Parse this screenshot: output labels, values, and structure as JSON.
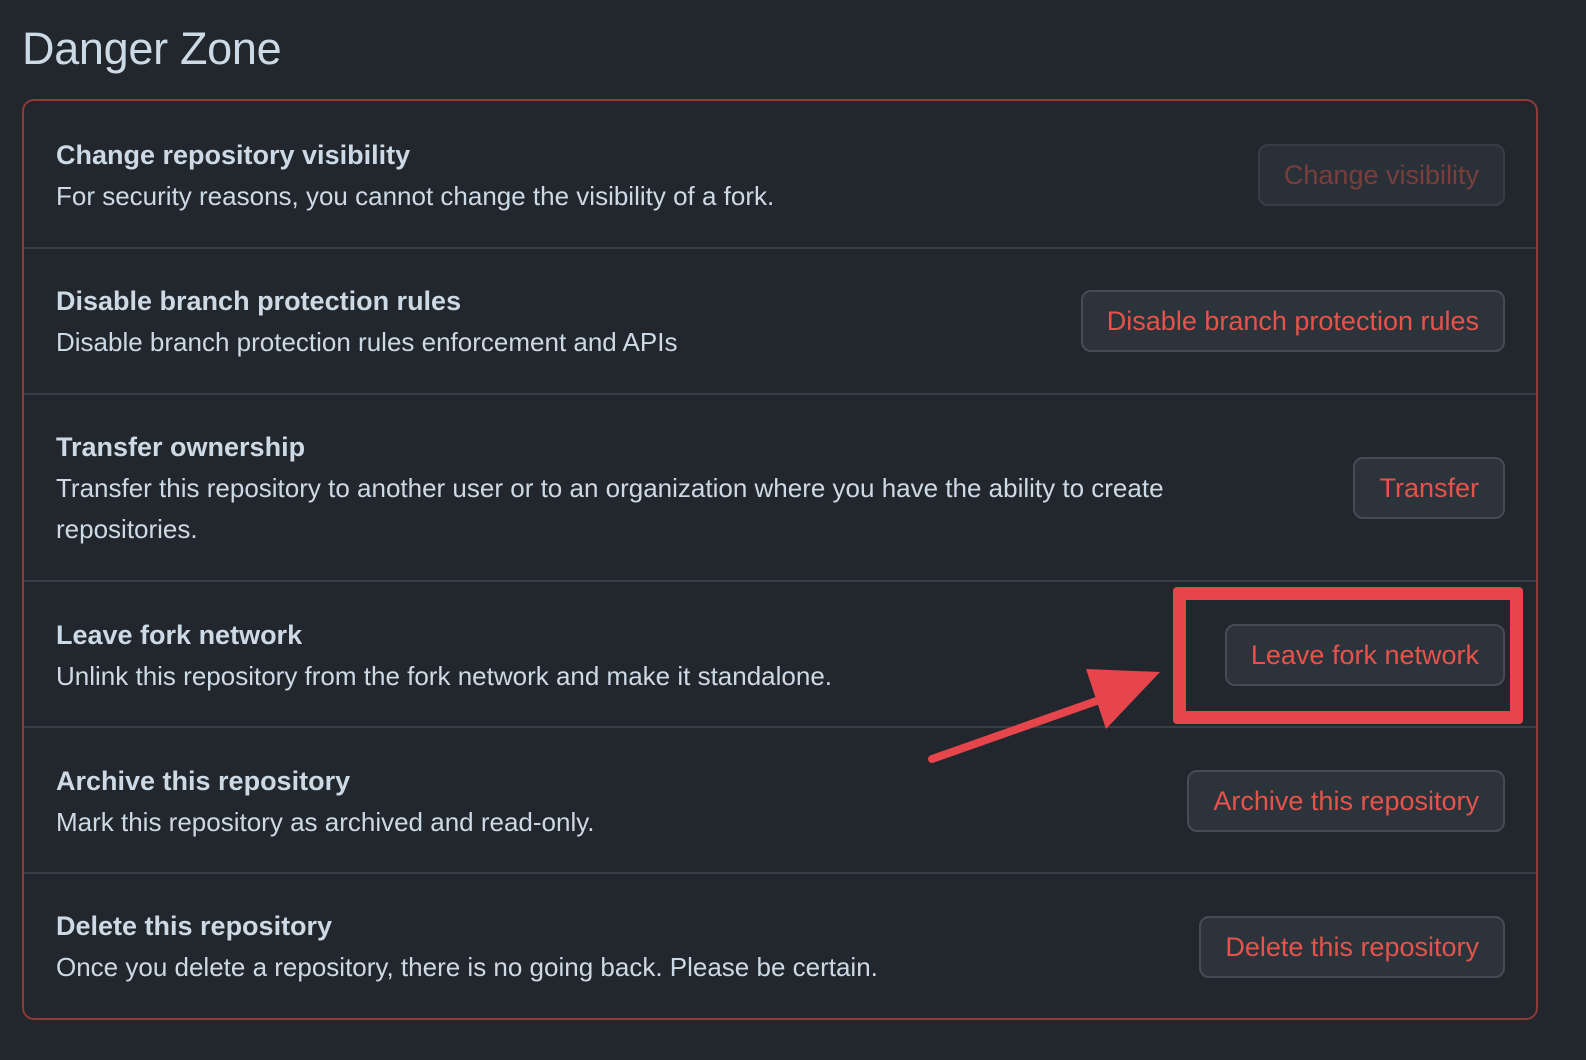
{
  "page": {
    "title": "Danger Zone"
  },
  "settings": [
    {
      "heading": "Change repository visibility",
      "description": "For security reasons, you cannot change the visibility of a fork.",
      "button": "Change visibility",
      "disabled": true
    },
    {
      "heading": "Disable branch protection rules",
      "description": "Disable branch protection rules enforcement and APIs",
      "button": "Disable branch protection rules",
      "disabled": false
    },
    {
      "heading": "Transfer ownership",
      "description": "Transfer this repository to another user or to an organization where you have the ability to create repositories.",
      "button": "Transfer",
      "disabled": false
    },
    {
      "heading": "Leave fork network",
      "description": "Unlink this repository from the fork network and make it standalone.",
      "button": "Leave fork network",
      "disabled": false
    },
    {
      "heading": "Archive this repository",
      "description": "Mark this repository as archived and read-only.",
      "button": "Archive this repository",
      "disabled": false
    },
    {
      "heading": "Delete this repository",
      "description": "Once you delete a repository, there is no going back. Please be certain.",
      "button": "Delete this repository",
      "disabled": false
    }
  ],
  "colors": {
    "background": "#22272e",
    "danger_border": "#8e3a36",
    "danger_text": "#e5534b",
    "annotation": "#e5454b"
  }
}
